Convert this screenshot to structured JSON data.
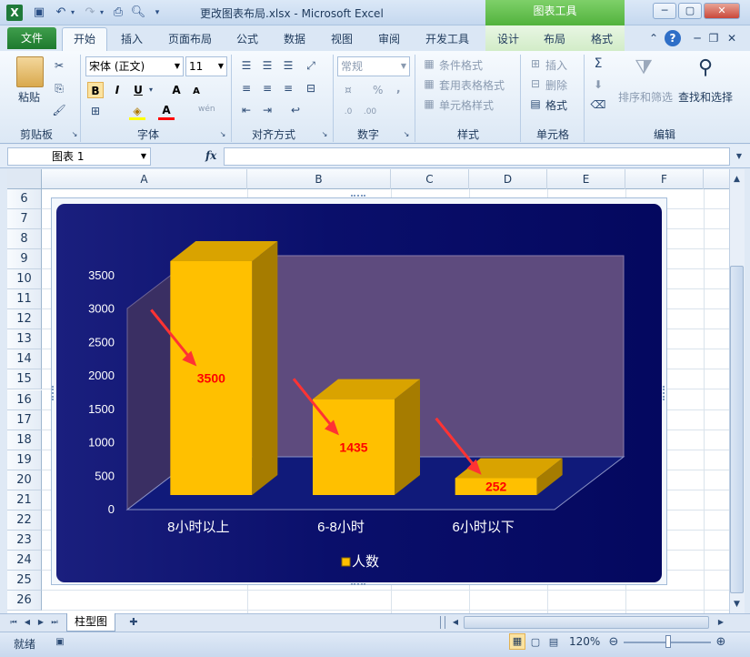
{
  "titlebar": {
    "title": "更改图表布局.xlsx - Microsoft Excel",
    "context_header": "图表工具",
    "app_icon": "X"
  },
  "tabs": {
    "file": "文件",
    "home": "开始",
    "insert": "插入",
    "page_layout": "页面布局",
    "formulas": "公式",
    "data": "数据",
    "review": "审阅",
    "view": "视图",
    "developer": "开发工具",
    "design": "设计",
    "layout": "布局",
    "format": "格式"
  },
  "ribbon": {
    "clipboard": {
      "paste": "粘贴",
      "label": "剪贴板"
    },
    "font": {
      "name": "宋体 (正文)",
      "size": "11",
      "bold": "B",
      "italic": "I",
      "underline": "U",
      "grow": "A",
      "shrink": "A",
      "color_letter": "A",
      "wen": "wén",
      "label": "字体"
    },
    "alignment": {
      "label": "对齐方式"
    },
    "number": {
      "format": "常规",
      "percent": "%",
      "comma": ",",
      "label": "数字"
    },
    "styles": {
      "conditional": "条件格式",
      "table": "套用表格格式",
      "cell": "单元格样式",
      "label": "样式"
    },
    "cells": {
      "insert": "插入",
      "delete": "删除",
      "format": "格式",
      "label": "单元格"
    },
    "editing": {
      "sort": "排序和筛选",
      "find": "查找和选择",
      "label": "编辑"
    }
  },
  "formula_bar": {
    "name_box": "图表 1",
    "fx": "fx",
    "value": ""
  },
  "columns": [
    "A",
    "B",
    "C",
    "D",
    "E",
    "F"
  ],
  "rows": [
    "6",
    "7",
    "8",
    "9",
    "10",
    "11",
    "12",
    "13",
    "14",
    "15",
    "16",
    "17",
    "18",
    "19",
    "20",
    "21",
    "22",
    "23",
    "24",
    "25",
    "26"
  ],
  "chart_data": {
    "type": "bar",
    "categories": [
      "8小时以上",
      "6-8小时",
      "6小时以下"
    ],
    "series": [
      {
        "name": "人数",
        "values": [
          3500,
          1435,
          252
        ]
      }
    ],
    "data_labels": [
      "3500",
      "1435",
      "252"
    ],
    "y_ticks": [
      "0",
      "500",
      "1000",
      "1500",
      "2000",
      "2500",
      "3000",
      "3500"
    ],
    "ylim": [
      0,
      3500
    ],
    "legend_position": "bottom",
    "style": "3d-column",
    "bar_color": "#ffc000",
    "label_color": "#ff0000",
    "background": "#0a0f6b"
  },
  "sheet_tab": {
    "name": "柱型图"
  },
  "status": {
    "ready": "就绪",
    "zoom": "120%"
  },
  "colors": {
    "accent_green": "#52b23d",
    "ribbon_blue": "#dce8f5"
  }
}
